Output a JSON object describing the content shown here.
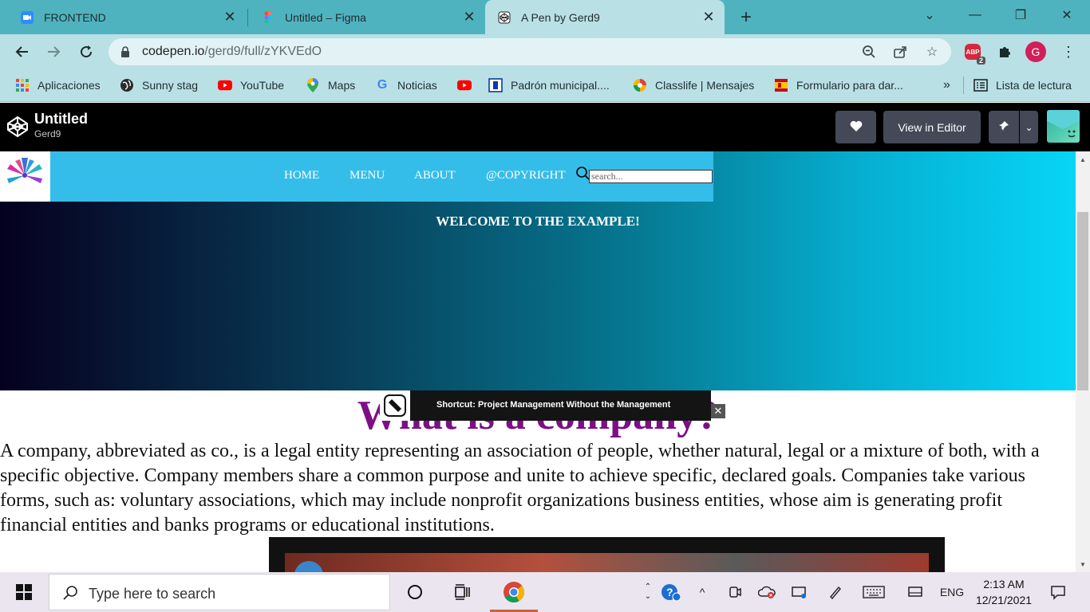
{
  "tabs": [
    {
      "title": "FRONTEND",
      "icon": "zoom-icon",
      "active": false
    },
    {
      "title": "Untitled – Figma",
      "icon": "figma-icon",
      "active": false
    },
    {
      "title": "A Pen by Gerd9",
      "icon": "codepen-icon",
      "active": true
    }
  ],
  "address": {
    "host": "codepen.io",
    "path": "/gerd9/full/zYKVEdO"
  },
  "extensions": {
    "abp_label": "ABP",
    "abp_badge": "2",
    "profile_initial": "G"
  },
  "bookmarks": [
    {
      "label": "Aplicaciones",
      "icon": "apps-grid-icon"
    },
    {
      "label": "Sunny stag",
      "icon": "globe-icon"
    },
    {
      "label": "YouTube",
      "icon": "youtube-icon"
    },
    {
      "label": "Maps",
      "icon": "maps-pin-icon"
    },
    {
      "label": "Noticias",
      "icon": "google-icon"
    },
    {
      "label": "",
      "icon": "youtube-icon"
    },
    {
      "label": "Padrón municipal....",
      "icon": "madrid-icon"
    },
    {
      "label": "Classlife | Mensajes",
      "icon": "classlife-icon"
    },
    {
      "label": "Formulario para dar...",
      "icon": "spain-crest-icon"
    }
  ],
  "bookmarks_overflow": "»",
  "reading_list": "Lista de lectura",
  "codepen": {
    "title": "Untitled",
    "user": "Gerd9",
    "view_in_editor": "View in Editor"
  },
  "site": {
    "nav": [
      "HOME",
      "MENU",
      "ABOUT",
      "@COPYRIGHT"
    ],
    "search_placeholder": "search...",
    "hero_title": "WELCOME TO THE EXAMPLE!",
    "heading": "What is a company?",
    "paragraph": "A company, abbreviated as co., is a legal entity representing an association of people, whether natural, legal or a mixture of both, with a specific objective. Company members share a common purpose and unite to achieve specific, declared goals. Companies take various forms, such as: voluntary associations, which may include nonprofit organizations business entities, whose aim is generating profit financial entities and banks programs or educational institutions."
  },
  "video": {
    "banner_text": "Shortcut: Project Management Without the Management"
  },
  "taskbar": {
    "search_placeholder": "Type here to search",
    "language": "ENG",
    "time": "2:13 AM",
    "date": "12/21/2021"
  },
  "colors": {
    "chrome_tabstrip": "#4fb3bf",
    "chrome_toolbar": "#b9e0e5",
    "site_nav": "#35bde9",
    "heading": "#7d0f86"
  }
}
